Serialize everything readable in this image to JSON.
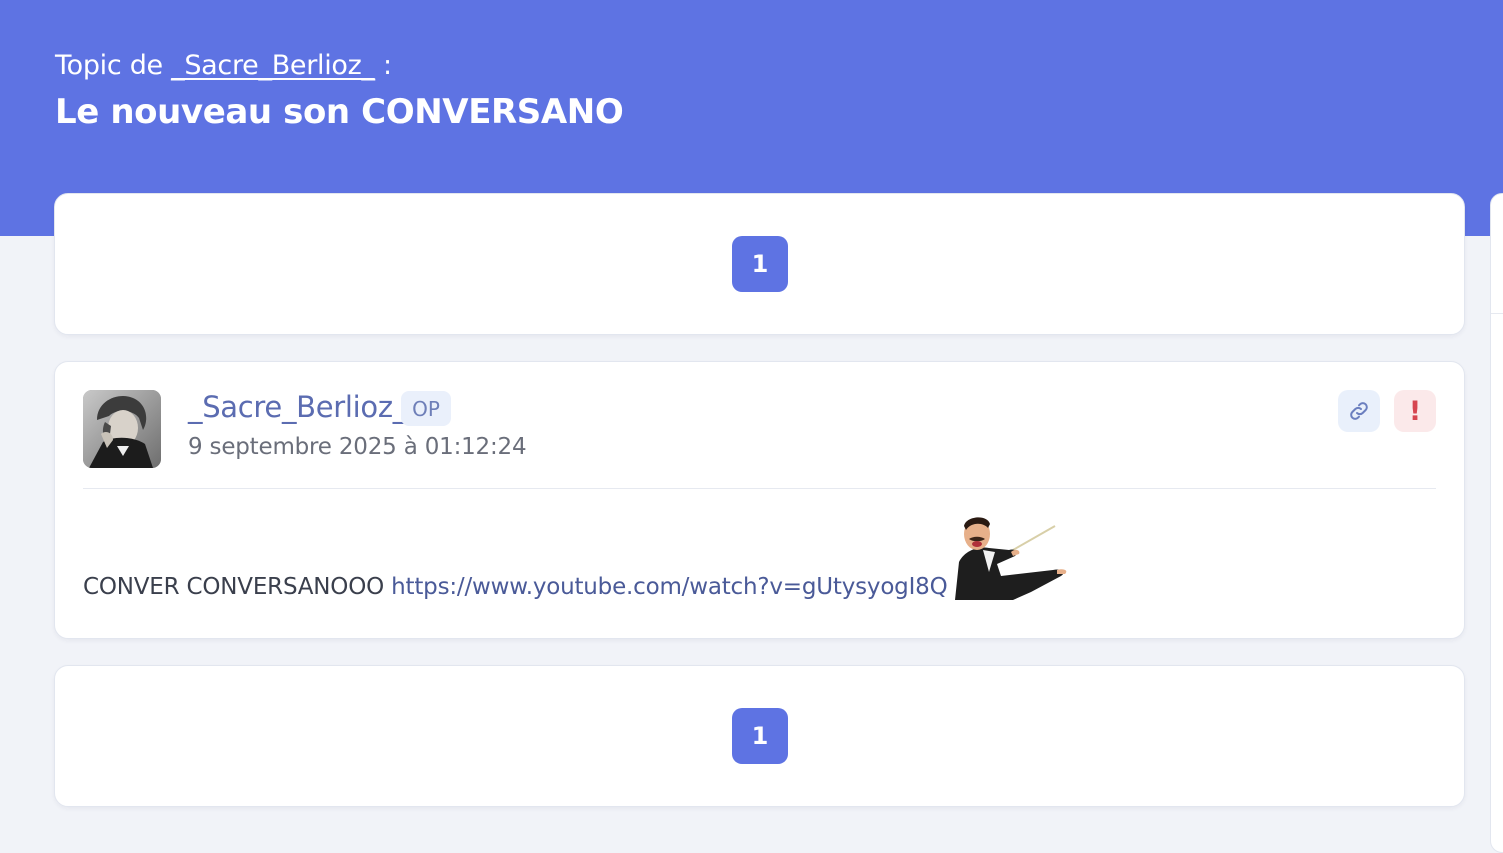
{
  "header": {
    "topic_prefix": "Topic de",
    "topic_author": "_Sacre_Berlioz_",
    "topic_suffix": ":",
    "title": "Le nouveau son CONVERSANO"
  },
  "pagination_top": {
    "current_page": "1"
  },
  "post": {
    "author": "_Sacre_Berlioz_",
    "badge": "OP",
    "date": "9 septembre 2025 à 01:12:24",
    "body_text": "CONVER CONVERSANOOO",
    "body_link": "https://www.youtube.com/watch?v=gUtysyogI8Q",
    "actions": {
      "link_icon": "link-icon",
      "report_icon": "exclamation-icon",
      "report_glyph": "!"
    }
  },
  "pagination_bottom": {
    "current_page": "1"
  },
  "colors": {
    "header_bg": "#5e73e3",
    "page_bg": "#f1f3f8",
    "accent": "#5e73e3",
    "author_link": "#5b6cb1",
    "report_red": "#d64550"
  }
}
